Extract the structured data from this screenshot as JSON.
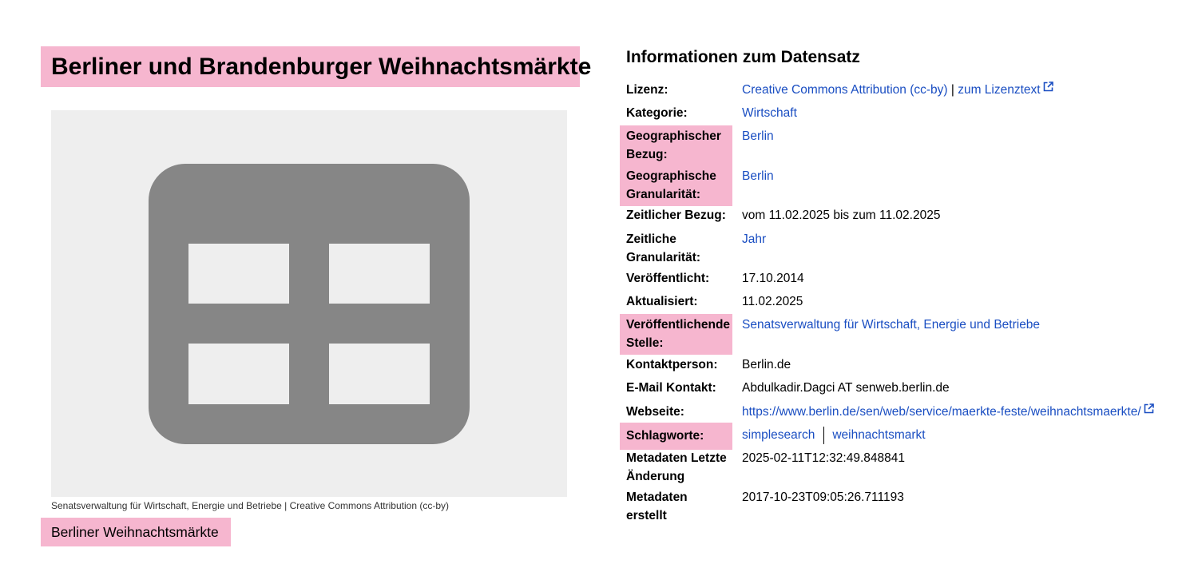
{
  "dataset": {
    "title": "Berliner und Brandenburger Weihnachtsmärkte",
    "preview_icon": "table-grid-icon",
    "caption": "Senatsverwaltung für Wirtschaft, Energie und Betriebe | Creative Commons Attribution (cc-by)",
    "resource_label": "Berliner Weihnachtsmärkte"
  },
  "info": {
    "heading": "Informationen zum Datensatz",
    "license_label": "Lizenz:",
    "license_value": "Creative Commons Attribution (cc-by)",
    "license_separator": "|",
    "license_link": "zum Lizenztext",
    "category_label": "Kategorie:",
    "category_value": "Wirtschaft",
    "geo_label_line1": "Geographischer",
    "geo_label_line2": "Bezug:",
    "geo_value": "Berlin",
    "geogran_label_line1": "Geographische",
    "geogran_label_line2": "Granularität:",
    "geogran_value": "Berlin",
    "time_label": "Zeitlicher Bezug:",
    "time_value": "vom 11.02.2025 bis zum 11.02.2025",
    "timegran_label_line1": "Zeitliche",
    "timegran_label_line2": "Granularität:",
    "timegran_value": "Jahr",
    "published_label": "Veröffentlicht:",
    "published_value": "17.10.2014",
    "updated_label": "Aktualisiert:",
    "updated_value": "11.02.2025",
    "publisher_label_line1": "Veröffentlichende",
    "publisher_label_line2": "Stelle:",
    "publisher_value": "Senatsverwaltung für Wirtschaft, Energie und Betriebe",
    "contact_label": "Kontaktperson:",
    "contact_value": "Berlin.de",
    "email_label": "E-Mail Kontakt:",
    "email_value": "Abdulkadir.Dagci AT senweb.berlin.de",
    "website_label": "Webseite:",
    "website_value": "https://www.berlin.de/sen/web/service/maerkte-feste/weihnachtsmaerkte/",
    "tags_label": "Schlagworte:",
    "tags": [
      "simplesearch",
      "weihnachtsmarkt"
    ],
    "meta_changed_label_line1": "Metadaten Letzte",
    "meta_changed_label_line2": "Änderung",
    "meta_changed_value": "2025-02-11T12:32:49.848841",
    "meta_created_label_line1": "Metadaten",
    "meta_created_label_line2": "erstellt",
    "meta_created_value": "2017-10-23T09:05:26.711193"
  },
  "colors": {
    "highlight": "#f6b6cf",
    "link": "#1a4ec2",
    "preview_bg": "#eeeeee",
    "icon_fill": "#868686"
  }
}
